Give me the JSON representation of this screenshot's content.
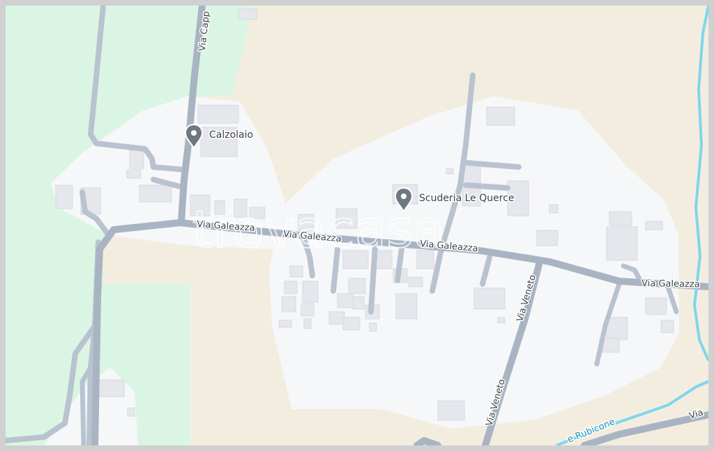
{
  "map": {
    "watermark": "trovacasa",
    "colors": {
      "background": "#f3ede0",
      "green_area": "#dbf5e4",
      "urban_area": "#f6f7f9",
      "road": "#b9c3d0",
      "main_road": "#a9b4c3",
      "river": "#7fd6ea",
      "building": "#e6e7ec",
      "pin": "#6f7880"
    },
    "roads": {
      "via_capp": "Via Capp",
      "via_galeazza_1": "Via Galeazza",
      "via_galeazza_2": "Via Galeazza",
      "via_galeazza_3": "Via Galeazza",
      "via_galeazza_4": "Via Galeazza",
      "via_veneto_1": "Via Veneto",
      "via_veneto_2": "Via Veneto",
      "via_bottom_right": "Via"
    },
    "water": {
      "river_label": "e Rubicone"
    },
    "pois": [
      {
        "label": "Calzolaio",
        "icon": "map-pin-icon"
      },
      {
        "label": "Scuderia Le Querce",
        "icon": "map-pin-icon"
      }
    ]
  }
}
